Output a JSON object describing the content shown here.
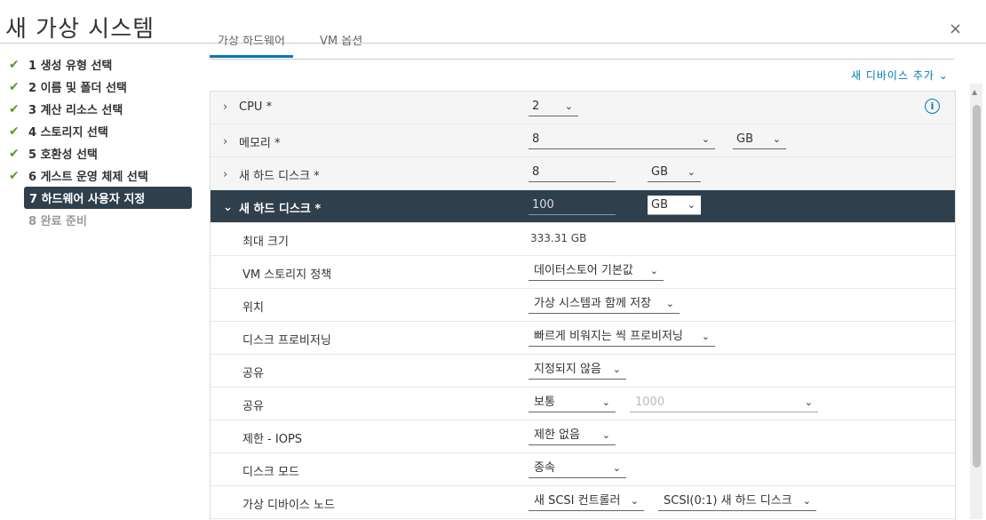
{
  "window": {
    "title": "새 가상 시스템",
    "close_label": "×"
  },
  "steps": [
    {
      "label": "1 생성 유형 선택",
      "done": true
    },
    {
      "label": "2 이름 및 폴더 선택",
      "done": true
    },
    {
      "label": "3 계산 리소스 선택",
      "done": true
    },
    {
      "label": "4 스토리지 선택",
      "done": true
    },
    {
      "label": "5 호환성 선택",
      "done": true
    },
    {
      "label": "6 게스트 운영 체제 선택",
      "done": true
    },
    {
      "label": "7 하드웨어 사용자 지정",
      "active": true
    },
    {
      "label": "8 완료 준비",
      "disabled": true
    }
  ],
  "check_glyph": "✔",
  "tabs": {
    "hardware": "가상 하드웨어",
    "vm_options": "VM 옵션"
  },
  "add_device": "새 디바이스 추가 ⌄",
  "rows": {
    "cpu": {
      "label": "CPU *",
      "value": "2"
    },
    "memory": {
      "label": "메모리 *",
      "value": "8",
      "unit": "GB"
    },
    "disk1": {
      "label": "새 하드 디스크 *",
      "value": "8",
      "unit": "GB"
    },
    "disk2": {
      "label": "새 하드 디스크 *",
      "value": "100",
      "unit": "GB"
    },
    "max_size": {
      "label": "최대 크기",
      "value": "333.31 GB"
    },
    "storage_policy": {
      "label": "VM 스토리지 정책",
      "value": "데이터스토어 기본값"
    },
    "location": {
      "label": "위치",
      "value": "가상 시스템과 함께 저장"
    },
    "provisioning": {
      "label": "디스크 프로비저닝",
      "value": "빠르게 비워지는 씩 프로비저닝"
    },
    "sharing": {
      "label": "공유",
      "value": "지정되지 않음"
    },
    "shares": {
      "label": "공유",
      "value": "보통",
      "amount_placeholder": "1000"
    },
    "limit_iops": {
      "label": "제한 - IOPS",
      "value": "제한 없음"
    },
    "disk_mode": {
      "label": "디스크 모드",
      "value": "종속"
    },
    "device_node": {
      "label": "가상 디바이스 노드",
      "controller": "새 SCSI 컨트롤러",
      "node": "SCSI(0:1) 새 하드 디스크"
    }
  },
  "colors": {
    "accent": "#0079b8",
    "active_bg": "#2f3f4c",
    "check": "#5a9a29"
  }
}
